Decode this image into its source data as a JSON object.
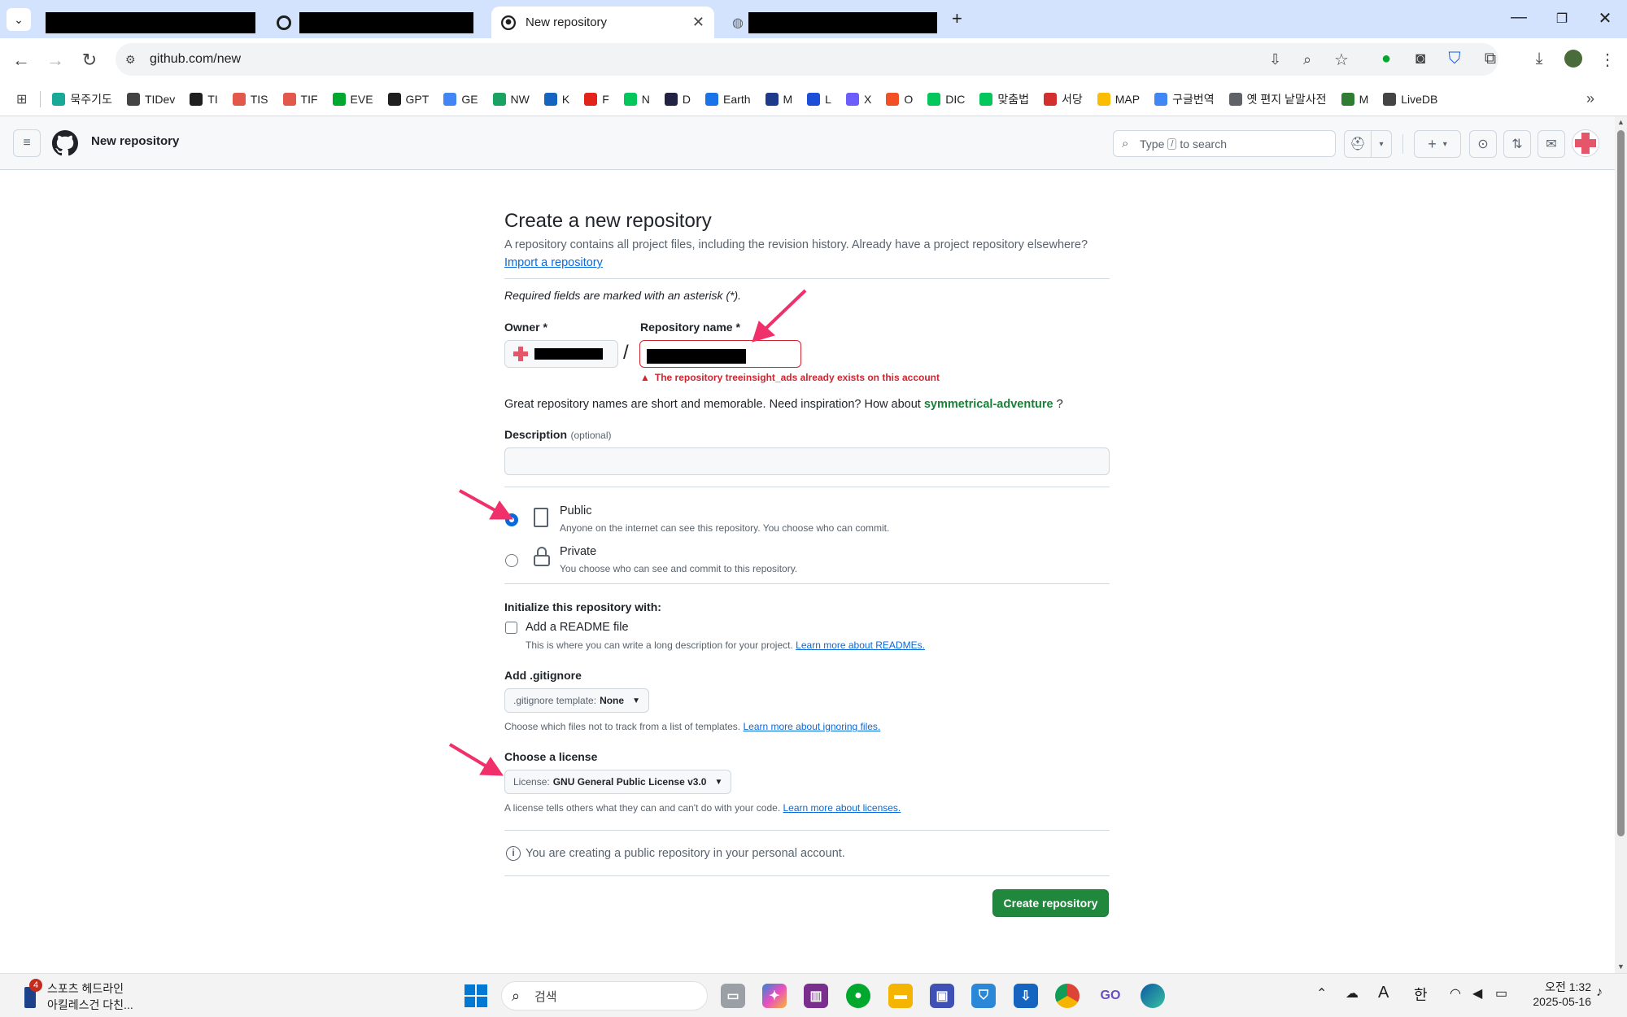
{
  "browser": {
    "active_tab_title": "New repository",
    "url": "github.com/new",
    "bookmarks": [
      {
        "label": "묵주기도",
        "color": "#18a999",
        "icon": "wave-icon"
      },
      {
        "label": "TIDev",
        "color": "#444444",
        "icon": "folder-icon"
      },
      {
        "label": "TI",
        "color": "#1f1f1f",
        "icon": "tree-icon"
      },
      {
        "label": "TIS",
        "color": "#e2584a",
        "icon": "t-circle-icon"
      },
      {
        "label": "TIF",
        "color": "#e2584a",
        "icon": "t-circle-icon"
      },
      {
        "label": "EVE",
        "color": "#00a82d",
        "icon": "evernote-icon"
      },
      {
        "label": "GPT",
        "color": "#1f1f1f",
        "icon": "openai-icon"
      },
      {
        "label": "GE",
        "color": "#4285f4",
        "icon": "gemini-icon"
      },
      {
        "label": "NW",
        "color": "#1aa260",
        "icon": "nw-icon"
      },
      {
        "label": "K",
        "color": "#1565c0",
        "icon": "b-icon"
      },
      {
        "label": "F",
        "color": "#e2231a",
        "icon": "adobe-icon"
      },
      {
        "label": "N",
        "color": "#03c75a",
        "icon": "naver-icon"
      },
      {
        "label": "D",
        "color": "#222244",
        "icon": "d-icon"
      },
      {
        "label": "Earth",
        "color": "#1a73e8",
        "icon": "globe-icon"
      },
      {
        "label": "M",
        "color": "#1e3a8a",
        "icon": "cloud-icon"
      },
      {
        "label": "L",
        "color": "#1d4ed8",
        "icon": "book-icon"
      },
      {
        "label": "X",
        "color": "#6d5dfc",
        "icon": "x-circle-icon"
      },
      {
        "label": "O",
        "color": "#f25022",
        "icon": "microsoft-icon"
      },
      {
        "label": "DIC",
        "color": "#03c75a",
        "icon": "dict-icon"
      },
      {
        "label": "맞춤법",
        "color": "#03c75a",
        "icon": "naver-icon"
      },
      {
        "label": "서당",
        "color": "#d32f2f",
        "icon": "seodang-icon"
      },
      {
        "label": "MAP",
        "color": "#fbbc04",
        "icon": "map-pin-icon"
      },
      {
        "label": "구글번역",
        "color": "#4285f4",
        "icon": "translate-icon"
      },
      {
        "label": "옛 편지 낱말사전",
        "color": "#5f6368",
        "icon": "globe-icon"
      },
      {
        "label": "M",
        "color": "#2e7d32",
        "icon": "creeper-icon"
      },
      {
        "label": "LiveDB",
        "color": "#444444",
        "icon": "folder-icon"
      }
    ],
    "more_bookmarks": "»"
  },
  "github": {
    "header_title": "New repository",
    "search_placeholder_pre": "Type",
    "search_key": "/",
    "search_placeholder_post": "to search"
  },
  "form": {
    "title": "Create a new repository",
    "subtitle": "A repository contains all project files, including the revision history. Already have a project repository elsewhere?",
    "import_link": "Import a repository",
    "required_note": "Required fields are marked with an asterisk (*).",
    "owner_label": "Owner *",
    "slash": "/",
    "repo_name_label": "Repository name *",
    "repo_error": "The repository treeinsight_ads already exists on this account",
    "suggestion_pre": "Great repository names are short and memorable. Need inspiration? How about",
    "suggestion_name": "symmetrical-adventure",
    "suggestion_post": "?",
    "description_label": "Description",
    "description_optional": "(optional)",
    "description_value": "",
    "visibility": [
      {
        "label": "Public",
        "desc": "Anyone on the internet can see this repository. You choose who can commit.",
        "checked": true
      },
      {
        "label": "Private",
        "desc": "You choose who can see and commit to this repository.",
        "checked": false
      }
    ],
    "init_label": "Initialize this repository with:",
    "readme_label": "Add a README file",
    "readme_desc": "This is where you can write a long description for your project.",
    "readme_link": "Learn more about READMEs.",
    "gitignore_label": "Add .gitignore",
    "gitignore_select_pre": ".gitignore template:",
    "gitignore_select_value": "None",
    "gitignore_desc": "Choose which files not to track from a list of templates.",
    "gitignore_link": "Learn more about ignoring files.",
    "license_label": "Choose a license",
    "license_select_pre": "License:",
    "license_select_value": "GNU General Public License v3.0",
    "license_desc": "A license tells others what they can and can't do with your code.",
    "license_link": "Learn more about licenses.",
    "info_note": "You are creating a public repository in your personal account.",
    "create_button": "Create repository"
  },
  "taskbar": {
    "news_badge": "4",
    "news_title": "스포츠 헤드라인",
    "news_sub": "아킬레스건 다친...",
    "search_label": "검색",
    "ime_a": "A",
    "ime_han": "한",
    "time": "오전 1:32",
    "date": "2025-05-16"
  },
  "colors": {
    "annotation_arrow": "#f0306a",
    "primary_button": "#1f883d",
    "error": "#d1242f",
    "link": "#0969da"
  }
}
